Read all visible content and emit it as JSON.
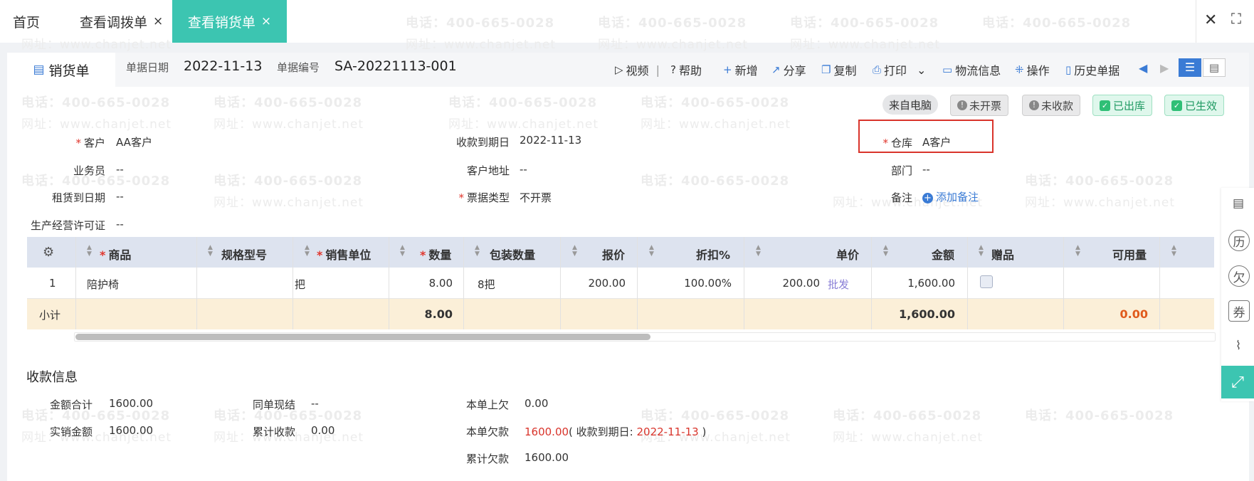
{
  "tabs": [
    {
      "label": "首页"
    },
    {
      "label": "查看调拨单",
      "close": "×"
    },
    {
      "label": "查看销货单",
      "close": "×"
    }
  ],
  "window_controls": {
    "close": "✕",
    "fullscreen": "⛶"
  },
  "doc": {
    "tab_label": "销货单",
    "date_label": "单据日期",
    "date_value": "2022-11-13",
    "number_label": "单据编号",
    "number_value": "SA-20221113-001"
  },
  "toolbar": {
    "video": "视频",
    "help": "帮助",
    "add": "新增",
    "share": "分享",
    "copy": "复制",
    "print": "打印",
    "logistics": "物流信息",
    "operate": "操作",
    "history": "历史单据"
  },
  "badges": {
    "source": "来自电脑",
    "invoice": "未开票",
    "payment": "未收款",
    "outbound": "已出库",
    "effective": "已生效"
  },
  "fields": {
    "customer_label": "客户",
    "customer_value": "AA客户",
    "due_label": "收款到期日",
    "due_value": "2022-11-13",
    "warehouse_label": "仓库",
    "warehouse_value": "A客户",
    "salesman_label": "业务员",
    "salesman_value": "--",
    "address_label": "客户地址",
    "address_value": "--",
    "dept_label": "部门",
    "dept_value": "--",
    "lease_label": "租赁到日期",
    "lease_value": "--",
    "invoice_type_label": "票据类型",
    "invoice_type_value": "不开票",
    "remark_label": "备注",
    "remark_add": "添加备注",
    "license_label": "生产经营许可证",
    "license_value": "--"
  },
  "table": {
    "headers": {
      "product": "商品",
      "spec": "规格型号",
      "unit": "销售单位",
      "qty": "数量",
      "pack_qty": "包装数量",
      "quote": "报价",
      "discount": "折扣%",
      "price": "单价",
      "amount": "金额",
      "gift": "赠品",
      "available": "可用量"
    },
    "rows": [
      {
        "no": "1",
        "product": "陪护椅",
        "unit": "把",
        "qty": "8.00",
        "pack_qty": "8把",
        "quote": "200.00",
        "discount": "100.00%",
        "price": "200.00",
        "price_tag": "批发",
        "amount": "1,600.00"
      }
    ],
    "subtotal": {
      "label": "小计",
      "qty": "8.00",
      "amount": "1,600.00",
      "available": "0.00"
    }
  },
  "payment": {
    "title": "收款信息",
    "total_label": "金额合计",
    "total_value": "1600.00",
    "actual_label": "实销金额",
    "actual_value": "1600.00",
    "cash_label": "同单现结",
    "cash_value": "--",
    "cumulative_label": "累计收款",
    "cumulative_value": "0.00",
    "prev_owed_label": "本单上欠",
    "prev_owed_value": "0.00",
    "owed_label": "本单欠款",
    "owed_value": "1600.00",
    "owed_due_prefix": "( 收款到期日: ",
    "owed_due_date": "2022-11-13",
    "owed_due_suffix": " )",
    "total_owed_label": "累计欠款",
    "total_owed_value": "1600.00"
  },
  "watermark": {
    "phone": "电话：400-665-0028",
    "site": "网址：www.chanjet.net"
  },
  "side_panel": {
    "icons": [
      "document-icon",
      "history-icon",
      "owe-icon",
      "coupon-icon",
      "attachment-icon",
      "expand-icon"
    ],
    "labels": {
      "history": "历",
      "owe": "欠",
      "coupon": "券"
    }
  },
  "colors": {
    "accent": "#3cc5b1",
    "required": "#e0362d",
    "highlight_box": "#d9342b",
    "link": "#3a7bd5",
    "subtotal_bg": "#fbefd8",
    "header_bg": "#dde3ef"
  }
}
